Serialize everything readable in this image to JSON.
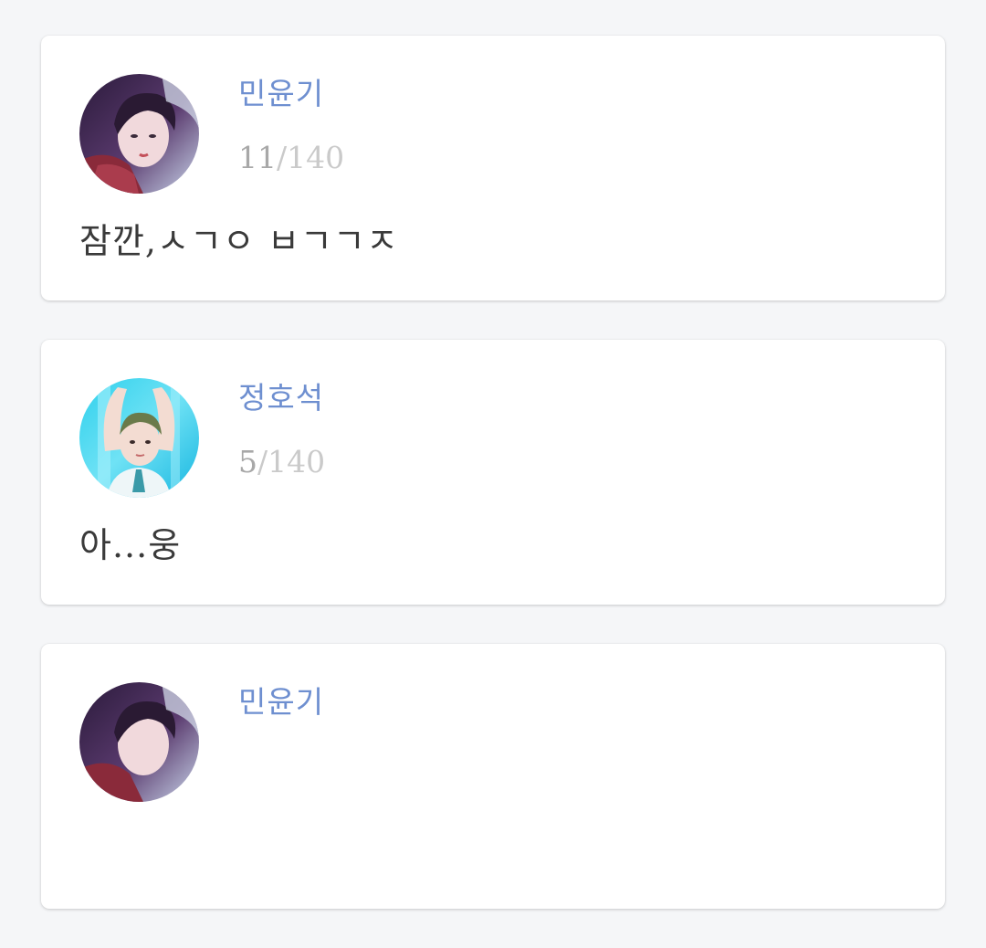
{
  "theme": {
    "page_background": "#f5f6f8",
    "card_background": "#ffffff",
    "name_color": "#6e8fd0",
    "text_color": "#3a3a3a"
  },
  "posts": [
    {
      "author": "민윤기",
      "avatar_icon": "profile-photo-icon",
      "count_current": "11",
      "count_separator": "/",
      "count_max": "140",
      "message": "잠깐,ㅅㄱㅇ ㅂㄱㄱㅈ"
    },
    {
      "author": "정호석",
      "avatar_icon": "profile-photo-icon",
      "count_current": "5",
      "count_separator": "/",
      "count_max": "140",
      "message": "아...웅"
    },
    {
      "author": "민윤기",
      "avatar_icon": "profile-photo-icon",
      "count_current": "",
      "count_separator": "",
      "count_max": "",
      "message": ""
    }
  ]
}
